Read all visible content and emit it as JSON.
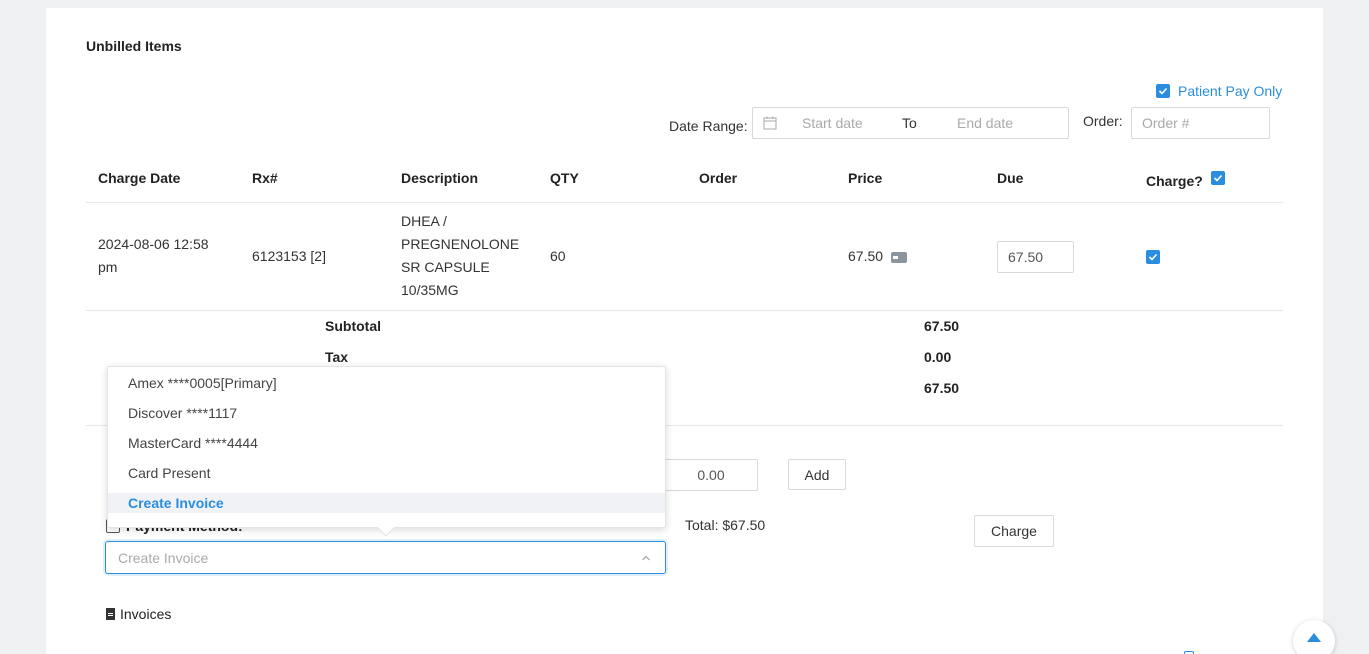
{
  "header": {
    "title": "Unbilled Items"
  },
  "filters": {
    "patient_pay_only": "Patient Pay Only",
    "date_range_label": "Date Range:",
    "start_placeholder": "Start date",
    "to_label": "To",
    "end_placeholder": "End date",
    "order_label": "Order:",
    "order_placeholder": "Order #"
  },
  "table": {
    "columns": [
      "Charge Date",
      "Rx#",
      "Description",
      "QTY",
      "Order",
      "Price",
      "Due",
      "Charge?"
    ],
    "rows": [
      {
        "charge_date": "2024-08-06 12:58 pm",
        "rx": "6123153 [2]",
        "description": "DHEA / PREGNENOLONE SR CAPSULE 10/35MG",
        "qty": "60",
        "order": "",
        "price": "67.50",
        "due": "67.50"
      }
    ]
  },
  "summary": {
    "subtotal_label": "Subtotal",
    "subtotal_value": "67.50",
    "tax_label": "Tax",
    "tax_value": "0.00",
    "total_value": "67.50"
  },
  "payment": {
    "amount_value": "0.00",
    "add_label": "Add",
    "method_label": "Payment Method:",
    "total_text": "Total: $67.50",
    "charge_label": "Charge",
    "select_value": "Create Invoice",
    "options": [
      "Amex ****0005[Primary]",
      "Discover ****1117",
      "MasterCard ****4444",
      "Card Present",
      "Create Invoice"
    ]
  },
  "invoices": {
    "label": "Invoices"
  },
  "colors": {
    "accent": "#2b8de0"
  }
}
